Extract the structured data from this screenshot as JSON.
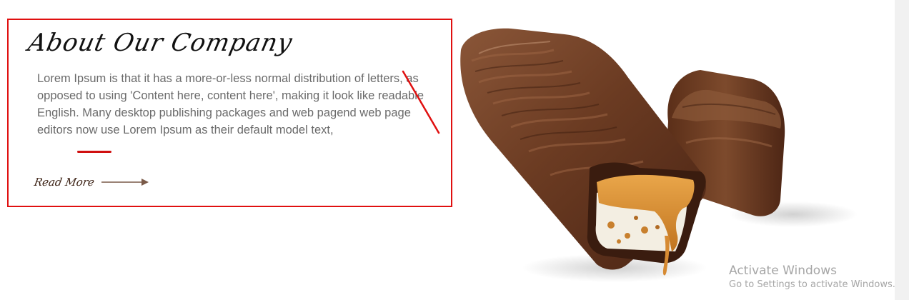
{
  "about": {
    "title": "About Our Company",
    "body": "Lorem Ipsum is that it has a more-or-less normal distribution of letters, as opposed to using 'Content here, content here', making it look like readable English. Many desktop publishing packages and web pagend web page editors now use Lorem Ipsum as their default model text,",
    "read_more": "Read More"
  },
  "image": {
    "subject": "chocolate-caramel-bar"
  },
  "watermark": {
    "title": "Activate Windows",
    "subtitle": "Go to Settings to activate Windows."
  },
  "colors": {
    "annotation_red": "#e01010",
    "chocolate": "#6b3b22",
    "caramel": "#d98a2e",
    "body_text": "#6a6a6a"
  }
}
